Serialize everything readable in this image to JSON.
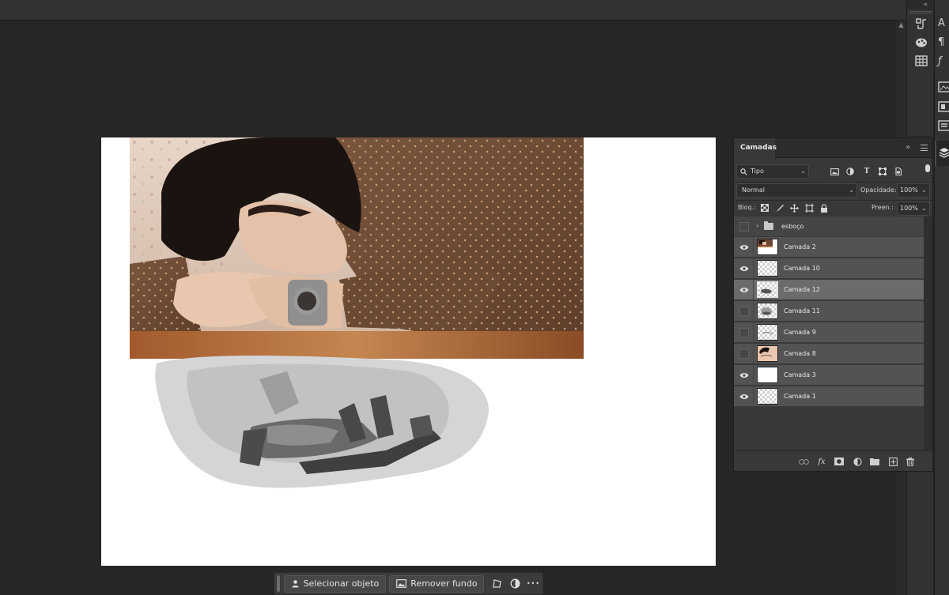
{
  "dock": {
    "collapse_label": "«"
  },
  "taskbar": {
    "select_object_label": "Selecionar objeto",
    "remove_background_label": "Remover fundo",
    "more_label": "•••"
  },
  "layers_panel": {
    "tab_label": "Camadas",
    "collapse_label": "»",
    "filter": {
      "value": "Tipo"
    },
    "blend_mode": {
      "value": "Normal"
    },
    "opacity": {
      "label": "Opacidade:",
      "value": "100%"
    },
    "lock": {
      "label": "Bloq.:"
    },
    "fill": {
      "label": "Preen.:",
      "value": "100%"
    },
    "layers": [
      {
        "name": "esboço",
        "type": "group",
        "visible": false
      },
      {
        "name": "Camada 2",
        "visible": true,
        "thumb": "photo"
      },
      {
        "name": "Camada 10",
        "visible": true,
        "thumb": "transparent"
      },
      {
        "name": "Camada 12",
        "visible": true,
        "thumb": "sketch",
        "selected": true
      },
      {
        "name": "Camada 11",
        "visible": false,
        "thumb": "sketch"
      },
      {
        "name": "Camada 9",
        "visible": false,
        "thumb": "transparent"
      },
      {
        "name": "Camada 8",
        "visible": false,
        "thumb": "portrait"
      },
      {
        "name": "Camada 3",
        "visible": true,
        "thumb": "white"
      },
      {
        "name": "Camada 1",
        "visible": true,
        "thumb": "transparent"
      }
    ]
  },
  "colors": {
    "workspace": "#262626",
    "panel": "#383838",
    "layer_row": "#535353",
    "layer_selected": "#6b6b6b"
  }
}
